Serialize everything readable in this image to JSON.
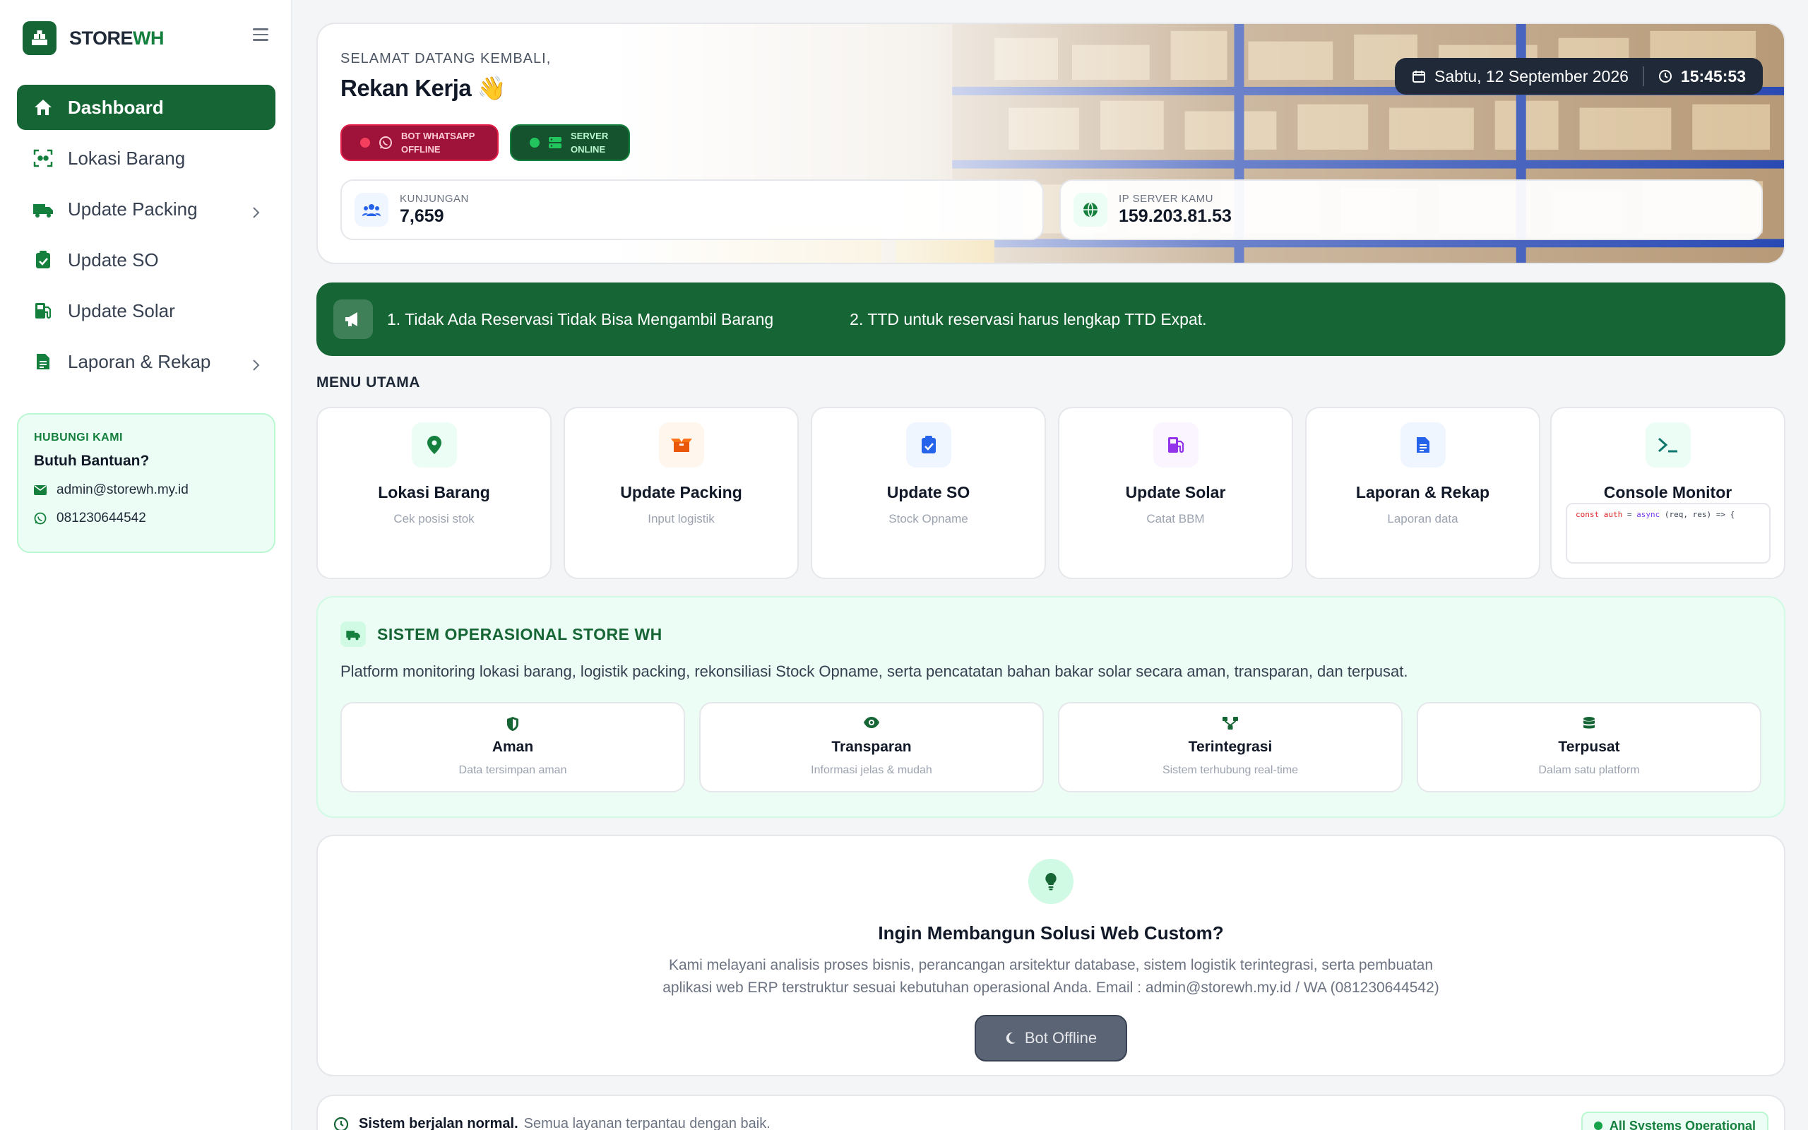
{
  "brand": {
    "prefix": "STORE",
    "accent": "WH"
  },
  "sidebar": {
    "items": [
      {
        "label": "Dashboard",
        "icon": "home-icon"
      },
      {
        "label": "Lokasi Barang",
        "icon": "scan-icon"
      },
      {
        "label": "Update Packing",
        "icon": "truck-icon"
      },
      {
        "label": "Update SO",
        "icon": "clipboard-check-icon"
      },
      {
        "label": "Update Solar",
        "icon": "gas-pump-icon"
      },
      {
        "label": "Laporan & Rekap",
        "icon": "file-icon"
      }
    ],
    "contact": {
      "label": "HUBUNGI KAMI",
      "title": "Butuh Bantuan?",
      "email": "admin@storewh.my.id",
      "phone": "081230644542"
    }
  },
  "hero": {
    "subtitle": "SELAMAT DATANG KEMBALI,",
    "title": "Rekan Kerja 👋",
    "bot_status": {
      "line1": "BOT WHATSAPP",
      "line2": "OFFLINE"
    },
    "server_status": {
      "line1": "SERVER",
      "line2": "ONLINE"
    },
    "date": "Sabtu, 12 September 2026",
    "time": "15:45:53",
    "visits": {
      "label": "KUNJUNGAN",
      "value": "7,659"
    },
    "ip": {
      "label": "IP SERVER KAMU",
      "value": "159.203.81.53"
    }
  },
  "announcements": [
    "1. Tidak Ada Reservasi Tidak Bisa Mengambil Barang",
    "2. TTD untuk reservasi harus lengkap TTD Expat."
  ],
  "menu": {
    "title": "MENU UTAMA",
    "cards": [
      {
        "title": "Lokasi Barang",
        "subtitle": "Cek posisi stok",
        "icon": "map-pin-icon",
        "color": "#15803d",
        "bg": "#ecfdf5"
      },
      {
        "title": "Update Packing",
        "subtitle": "Input logistik",
        "icon": "box-open-icon",
        "color": "#ea580c",
        "bg": "#fff7ed"
      },
      {
        "title": "Update SO",
        "subtitle": "Stock Opname",
        "icon": "clipboard-check-icon",
        "color": "#2563eb",
        "bg": "#eff6ff"
      },
      {
        "title": "Update Solar",
        "subtitle": "Catat BBM",
        "icon": "gas-pump-icon",
        "color": "#9333ea",
        "bg": "#faf5ff"
      },
      {
        "title": "Laporan & Rekap",
        "subtitle": "Laporan data",
        "icon": "file-lines-icon",
        "color": "#2563eb",
        "bg": "#eff6ff"
      },
      {
        "title": "Console Monitor",
        "subtitle": "",
        "icon": "terminal-icon",
        "color": "#0f766e",
        "bg": "#ecfdf5"
      }
    ],
    "console": {
      "kw1": "const",
      "name": "auth",
      "eq": " = ",
      "kw2": "async",
      "args": " (req, res) => {"
    }
  },
  "system": {
    "title": "SISTEM OPERASIONAL STORE WH",
    "description": "Platform monitoring lokasi barang, logistik packing, rekonsiliasi Stock Opname, serta pencatatan bahan bakar solar secara aman, transparan, dan terpusat.",
    "features": [
      {
        "title": "Aman",
        "subtitle": "Data tersimpan aman",
        "icon": "shield-icon"
      },
      {
        "title": "Transparan",
        "subtitle": "Informasi jelas & mudah",
        "icon": "eye-icon"
      },
      {
        "title": "Terintegrasi",
        "subtitle": "Sistem terhubung real-time",
        "icon": "network-icon"
      },
      {
        "title": "Terpusat",
        "subtitle": "Dalam satu platform",
        "icon": "database-icon"
      }
    ]
  },
  "custom": {
    "title": "Ingin Membangun Solusi Web Custom?",
    "description": "Kami melayani analisis proses bisnis, perancangan arsitektur database, sistem logistik terintegrasi, serta pembuatan aplikasi web ERP terstruktur sesuai kebutuhan operasional Anda. Email : admin@storewh.my.id / WA (081230644542)",
    "button": "Bot Offline"
  },
  "statusbar": {
    "bold": "Sistem berjalan normal.",
    "muted": "Semua layanan terpantau dengan baik.",
    "badge": "All Systems Operational"
  },
  "colors": {
    "brand": "#166534",
    "accent": "#15803d",
    "danger": "#9f1239"
  }
}
